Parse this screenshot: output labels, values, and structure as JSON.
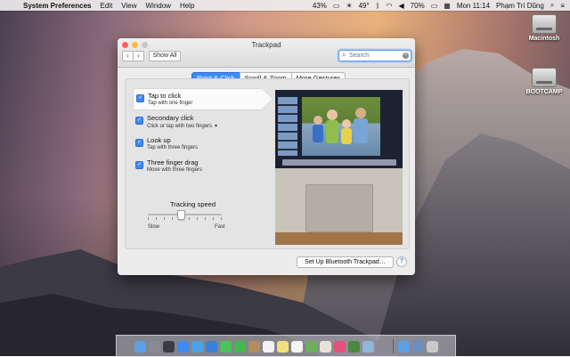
{
  "menubar": {
    "apple": "",
    "app_name": "System Preferences",
    "menus": [
      "Edit",
      "View",
      "Window",
      "Help"
    ],
    "status": {
      "spotlight": "🔔",
      "battery_pct": "43%",
      "weather": "49°",
      "wifi": "70%",
      "flag": "🇺🇸",
      "clock": "Mon 11:14",
      "user": "Phạm Trí Dũng"
    }
  },
  "desktop": {
    "drives": [
      "Macintosh",
      "BOOTCAMP"
    ]
  },
  "window": {
    "title": "Trackpad",
    "show_all": "Show All",
    "search_placeholder": "Search",
    "tabs": [
      "Point & Click",
      "Scroll & Zoom",
      "More Gestures"
    ],
    "active_tab": "Point & Click",
    "options": [
      {
        "title": "Tap to click",
        "subtitle": "Tap with one finger",
        "checked": true
      },
      {
        "title": "Secondary click",
        "subtitle": "Click or tap with two fingers",
        "checked": true
      },
      {
        "title": "Look up",
        "subtitle": "Tap with three fingers",
        "checked": true
      },
      {
        "title": "Three finger drag",
        "subtitle": "Move with three fingers",
        "checked": true
      }
    ],
    "tracking": {
      "label": "Tracking speed",
      "min_label": "Slow",
      "max_label": "Fast",
      "value_fraction": 0.45
    },
    "bluetooth_button": "Set Up Bluetooth Trackpad…",
    "help": "?"
  },
  "colors": {
    "accent": "#3d8bf3"
  },
  "dock": {
    "icons": [
      "finder-icon",
      "launchpad-icon",
      "mission-control-icon",
      "app-store-icon",
      "safari-icon",
      "mail-icon",
      "messages-icon",
      "facetime-icon",
      "contacts-icon",
      "calendar-icon",
      "notes-icon",
      "reminders-icon",
      "maps-icon",
      "photos-icon",
      "itunes-icon",
      "chrome-icon",
      "preview-icon",
      "system-preferences-icon",
      "downloads-icon",
      "documents-icon",
      "trash-icon"
    ]
  }
}
